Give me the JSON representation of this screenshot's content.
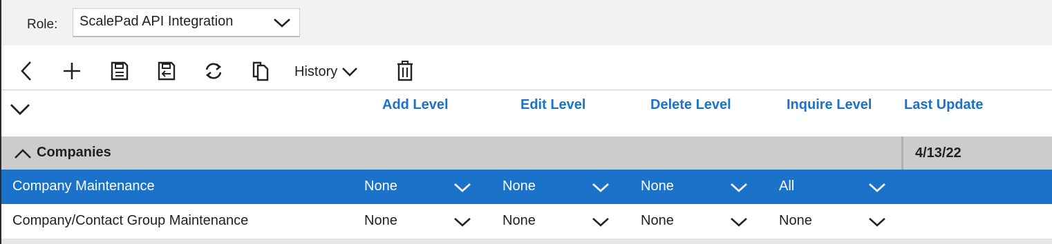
{
  "role": {
    "label": "Role:",
    "selected": "ScalePad API Integration"
  },
  "toolbar": {
    "back_icon": "chevron-left-icon",
    "add_icon": "plus-icon",
    "save_icon": "save-icon",
    "save_close_icon": "save-and-close-icon",
    "refresh_icon": "refresh-icon",
    "copy_icon": "copy-icon",
    "history_label": "History",
    "delete_icon": "trash-icon"
  },
  "columns": {
    "add": "Add Level",
    "edit": "Edit Level",
    "delete": "Delete Level",
    "inquire": "Inquire Level",
    "last_update": "Last Update"
  },
  "groups": [
    {
      "title": "Companies",
      "last_update": "4/13/22",
      "rows": [
        {
          "name": "Company Maintenance",
          "add": "None",
          "edit": "None",
          "delete": "None",
          "inquire": "All",
          "selected": true
        },
        {
          "name": "Company/Contact Group Maintenance",
          "add": "None",
          "edit": "None",
          "delete": "None",
          "inquire": "None",
          "selected": false
        }
      ]
    }
  ],
  "colors": {
    "accent": "#1a72c9",
    "group_bg": "#cccccc",
    "role_bar_bg": "#f2f2f2"
  }
}
